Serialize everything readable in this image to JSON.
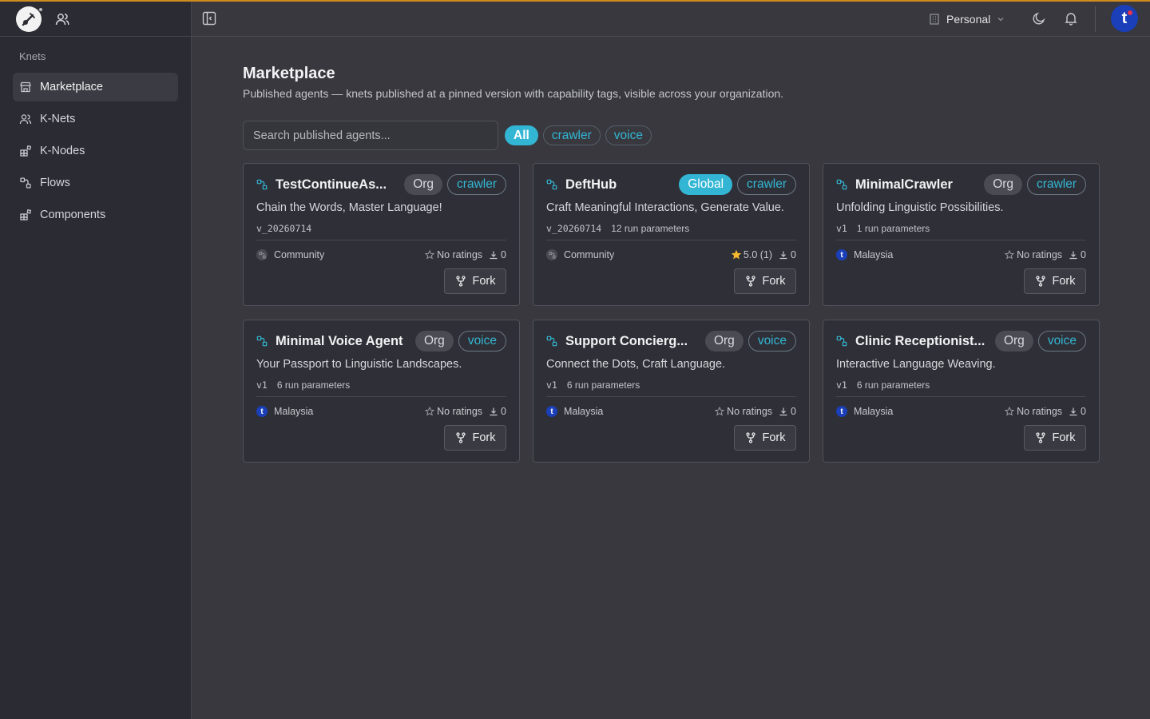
{
  "sidebar": {
    "section_label": "Knets",
    "items": [
      {
        "label": "Marketplace",
        "icon": "store-icon",
        "active": true
      },
      {
        "label": "K-Nets",
        "icon": "users-icon",
        "active": false
      },
      {
        "label": "K-Nodes",
        "icon": "blocks-icon",
        "active": false
      },
      {
        "label": "Flows",
        "icon": "flow-icon",
        "active": false
      },
      {
        "label": "Components",
        "icon": "blocks-icon",
        "active": false
      }
    ]
  },
  "header": {
    "workspace": "Personal",
    "avatar_letter": "t"
  },
  "main": {
    "title": "Marketplace",
    "subtitle": "Published agents — knets published at a pinned version with capability tags, visible across your organization.",
    "search_placeholder": "Search published agents...",
    "filters": [
      {
        "label": "All",
        "active": true
      },
      {
        "label": "crawler",
        "active": false
      },
      {
        "label": "voice",
        "active": false
      }
    ]
  },
  "cards": [
    {
      "title": "TestContinueAs...",
      "scope": "Org",
      "tag": "crawler",
      "description": "Chain the Words, Master Language!",
      "version": "v_20260714",
      "params": "",
      "owner": "Community",
      "owner_type": "community",
      "rating": "No ratings",
      "rated": false,
      "downloads": "0",
      "fork_label": "Fork"
    },
    {
      "title": "DeftHub",
      "scope": "Global",
      "tag": "crawler",
      "description": "Craft Meaningful Interactions, Generate Value.",
      "version": "v_20260714",
      "params": "12 run parameters",
      "owner": "Community",
      "owner_type": "community",
      "rating": "5.0 (1)",
      "rated": true,
      "downloads": "0",
      "fork_label": "Fork"
    },
    {
      "title": "MinimalCrawler",
      "scope": "Org",
      "tag": "crawler",
      "description": "Unfolding Linguistic Possibilities.",
      "version": "v1",
      "params": "1 run parameters",
      "owner": "Malaysia",
      "owner_type": "tm",
      "rating": "No ratings",
      "rated": false,
      "downloads": "0",
      "fork_label": "Fork"
    },
    {
      "title": "Minimal Voice Agent",
      "scope": "Org",
      "tag": "voice",
      "description": "Your Passport to Linguistic Landscapes.",
      "version": "v1",
      "params": "6 run parameters",
      "owner": "Malaysia",
      "owner_type": "tm",
      "rating": "No ratings",
      "rated": false,
      "downloads": "0",
      "fork_label": "Fork"
    },
    {
      "title": "Support Concierg...",
      "scope": "Org",
      "tag": "voice",
      "description": "Connect the Dots, Craft Language.",
      "version": "v1",
      "params": "6 run parameters",
      "owner": "Malaysia",
      "owner_type": "tm",
      "rating": "No ratings",
      "rated": false,
      "downloads": "0",
      "fork_label": "Fork"
    },
    {
      "title": "Clinic Receptionist...",
      "scope": "Org",
      "tag": "voice",
      "description": "Interactive Language Weaving.",
      "version": "v1",
      "params": "6 run parameters",
      "owner": "Malaysia",
      "owner_type": "tm",
      "rating": "No ratings",
      "rated": false,
      "downloads": "0",
      "fork_label": "Fork"
    }
  ],
  "colors": {
    "accent": "#33b6d4",
    "top_line": "#d08c1e",
    "star": "#f5b82e",
    "avatar_bg": "#1a3fb8"
  }
}
